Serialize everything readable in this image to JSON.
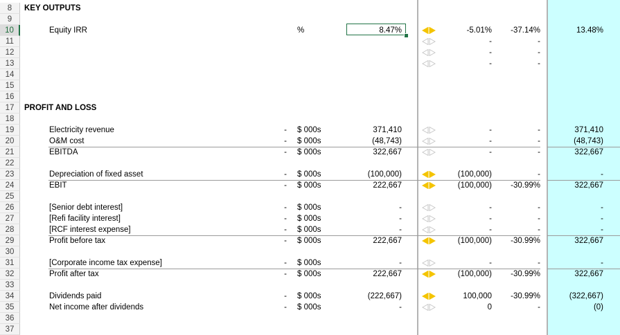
{
  "colors": {
    "accent_green": "#217346",
    "cyan_fill": "#ccffff",
    "arrow_active": "#f4c400",
    "arrow_inactive": "#c8c8c8"
  },
  "rows": [
    {
      "num": "8",
      "section": "KEY OUTPUTS"
    },
    {
      "num": "9"
    },
    {
      "num": "10",
      "label": "Equity IRR",
      "unit": "%",
      "value": "8.47%",
      "arrow": "active",
      "a": "-5.01%",
      "b": "-37.14%",
      "c": "13.48%",
      "selected": true
    },
    {
      "num": "11",
      "arrow": "inactive",
      "b": "-",
      "bb": "-"
    },
    {
      "num": "12",
      "arrow": "inactive",
      "b": "-",
      "bb": "-"
    },
    {
      "num": "13",
      "arrow": "inactive",
      "b": "-",
      "bb": "-"
    },
    {
      "num": "14"
    },
    {
      "num": "15"
    },
    {
      "num": "16"
    },
    {
      "num": "17",
      "section": "PROFIT AND LOSS"
    },
    {
      "num": "18"
    },
    {
      "num": "19",
      "label": "Electricity revenue",
      "flag": "-",
      "unit": "$ 000s",
      "value": "371,410",
      "arrow": "inactive",
      "b": "-",
      "bb": "-",
      "c": "371,410"
    },
    {
      "num": "20",
      "label": "O&M cost",
      "flag": "-",
      "unit": "$ 000s",
      "value": "(48,743)",
      "arrow": "inactive",
      "b": "-",
      "bb": "-",
      "c": "(48,743)"
    },
    {
      "num": "21",
      "label": "EBITDA",
      "flag": "-",
      "unit": "$ 000s",
      "value": "322,667",
      "arrow": "inactive",
      "b": "-",
      "bb": "-",
      "c": "322,667",
      "total": true
    },
    {
      "num": "22"
    },
    {
      "num": "23",
      "label": "Depreciation of fixed asset",
      "flag": "-",
      "unit": "$ 000s",
      "value": "(100,000)",
      "arrow": "active",
      "a": "(100,000)",
      "bb": "-",
      "c": "-"
    },
    {
      "num": "24",
      "label": "EBIT",
      "flag": "-",
      "unit": "$ 000s",
      "value": "222,667",
      "arrow": "active",
      "a": "(100,000)",
      "b": "-30.99%",
      "c": "322,667",
      "total": true
    },
    {
      "num": "25"
    },
    {
      "num": "26",
      "label": "[Senior debt interest]",
      "flag": "-",
      "unit": "$ 000s",
      "value": "-",
      "arrow": "inactive",
      "b": "-",
      "bb": "-",
      "c": "-"
    },
    {
      "num": "27",
      "label": "[Refi facility interest]",
      "flag": "-",
      "unit": "$ 000s",
      "value": "-",
      "arrow": "inactive",
      "b": "-",
      "bb": "-",
      "c": "-"
    },
    {
      "num": "28",
      "label": "[RCF interest expense]",
      "flag": "-",
      "unit": "$ 000s",
      "value": "-",
      "arrow": "inactive",
      "b": "-",
      "bb": "-",
      "c": "-"
    },
    {
      "num": "29",
      "label": "Profit before tax",
      "flag": "-",
      "unit": "$ 000s",
      "value": "222,667",
      "arrow": "active",
      "a": "(100,000)",
      "b": "-30.99%",
      "c": "322,667",
      "total": true
    },
    {
      "num": "30"
    },
    {
      "num": "31",
      "label": "[Corporate income tax expense]",
      "flag": "-",
      "unit": "$ 000s",
      "value": "-",
      "arrow": "inactive",
      "b": "-",
      "bb": "-",
      "c": "-"
    },
    {
      "num": "32",
      "label": "Profit after tax",
      "flag": "-",
      "unit": "$ 000s",
      "value": "222,667",
      "arrow": "active",
      "a": "(100,000)",
      "b": "-30.99%",
      "c": "322,667",
      "total": true
    },
    {
      "num": "33"
    },
    {
      "num": "34",
      "label": "Dividends paid",
      "flag": "-",
      "unit": "$ 000s",
      "value": "(222,667)",
      "arrow": "active",
      "a": "100,000",
      "b": "-30.99%",
      "c": "(322,667)"
    },
    {
      "num": "35",
      "label": "Net income after dividends",
      "flag": "-",
      "unit": "$ 000s",
      "value": "-",
      "arrow": "inactive",
      "a": "0",
      "bb": "-",
      "c": "(0)"
    },
    {
      "num": "36"
    },
    {
      "num": "37"
    }
  ]
}
